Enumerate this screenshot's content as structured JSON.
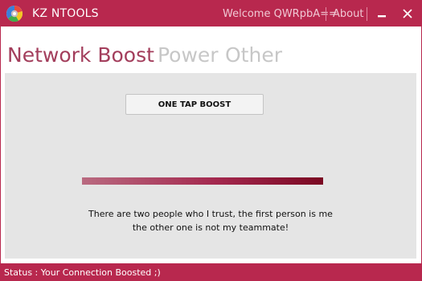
{
  "window": {
    "title": "KZ NTOOLS",
    "welcome_text": "Welcome QWRpbA==",
    "about_label": "About",
    "minimize_icon": "minimize-icon",
    "close_icon": "close-icon",
    "logo_icon": "app-logo-icon"
  },
  "tabs": [
    {
      "label": "Network Boost",
      "active": true
    },
    {
      "label": "Power",
      "active": false
    },
    {
      "label": "Other",
      "active": false
    }
  ],
  "main": {
    "boost_button_label": "ONE TAP BOOST",
    "progress_fraction": 1.0,
    "quote_line_1": "There are two people who I trust, the first person is me",
    "quote_line_2": "the other one is not my teammate!"
  },
  "status": {
    "text": "Status : Your Connection Boosted ;)"
  },
  "colors": {
    "accent": "#b8284e",
    "active_tab": "#a33e5c",
    "inactive_tab": "#c7c7c7",
    "panel_bg": "#e5e5e5"
  }
}
